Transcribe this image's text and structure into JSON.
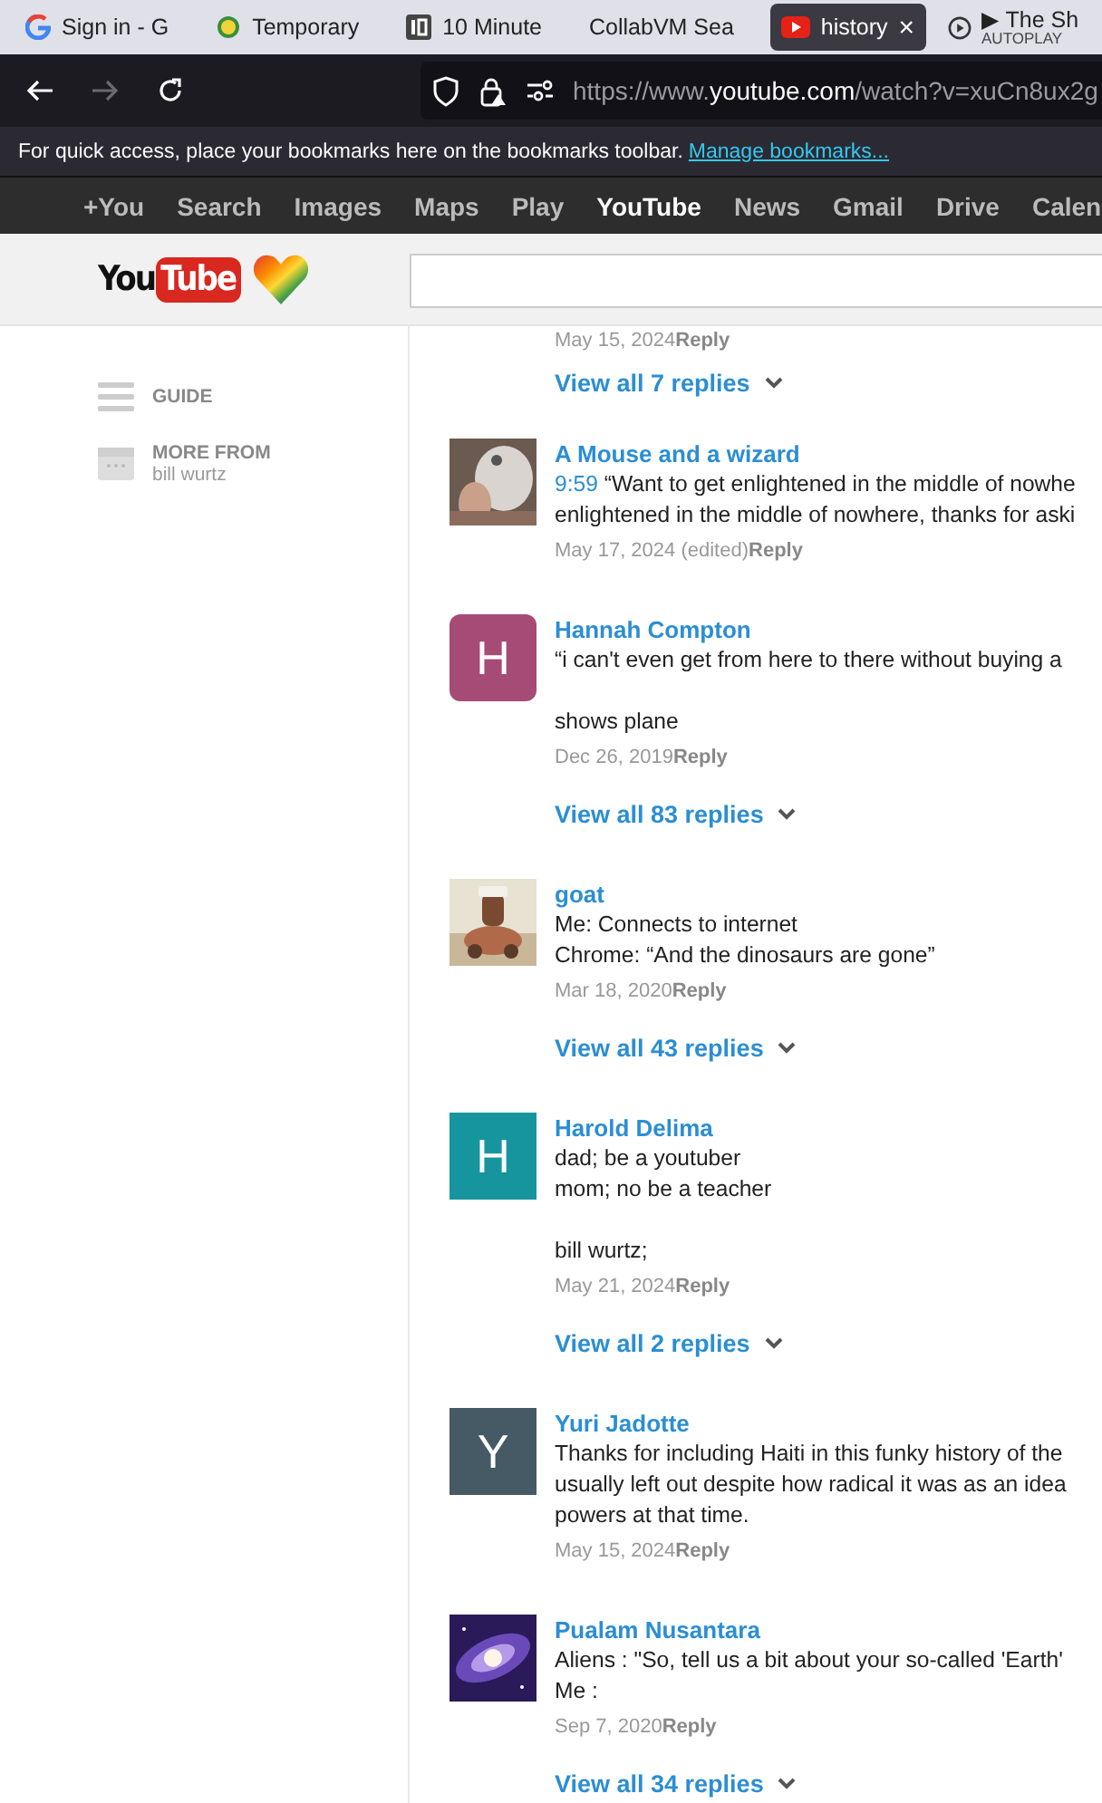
{
  "tabs": [
    {
      "label": "Sign in - G",
      "selected": false
    },
    {
      "label": "Temporary",
      "selected": false
    },
    {
      "label": "10 Minute",
      "selected": false
    },
    {
      "label": "CollabVM Sea",
      "selected": false
    },
    {
      "label": "history",
      "selected": true,
      "close": "×"
    },
    {
      "label": "▶ The Sh",
      "sublabel": "AUTOPLAY",
      "selected": false
    }
  ],
  "address_bar": {
    "url_prefix": "https://www.",
    "url_host": "youtube.com",
    "url_rest": "/watch?v=xuCn8ux2g"
  },
  "bookmarks_hint": {
    "text": "For quick access, place your bookmarks here on the bookmarks toolbar.",
    "link": "Manage bookmarks..."
  },
  "google_bar": [
    {
      "label": "+You",
      "selected": false
    },
    {
      "label": "Search",
      "selected": false
    },
    {
      "label": "Images",
      "selected": false
    },
    {
      "label": "Maps",
      "selected": false
    },
    {
      "label": "Play",
      "selected": false
    },
    {
      "label": "YouTube",
      "selected": true
    },
    {
      "label": "News",
      "selected": false
    },
    {
      "label": "Gmail",
      "selected": false
    },
    {
      "label": "Drive",
      "selected": false
    },
    {
      "label": "Calen",
      "selected": false
    }
  ],
  "logo": {
    "left": "You",
    "right": "Tube"
  },
  "sidebar": {
    "items": [
      {
        "kind": "guide",
        "label": "GUIDE"
      },
      {
        "kind": "channel",
        "label": "MORE FROM",
        "sublabel": "bill wurtz"
      }
    ]
  },
  "top_fragment": {
    "date": "May 15, 2024",
    "reply": "Reply",
    "replies": "View all 7 replies"
  },
  "comments": [
    {
      "author": "A Mouse and a wizard",
      "avatar": {
        "kind": "picture"
      },
      "timestamp": "9:59",
      "paragraphs": [
        [
          "“Want to get enlightened in the middle of nowhe",
          "enlightened in the middle of nowhere, thanks for aski"
        ]
      ],
      "date": "May 17, 2024 (edited)",
      "reply": "Reply"
    },
    {
      "author": "Hannah Compton",
      "avatar": {
        "kind": "letter",
        "initial": "H",
        "color": "#a64b76"
      },
      "paragraphs": [
        [
          "“i can't even get from here to there without buying a"
        ],
        [
          "shows plane"
        ]
      ],
      "date": "Dec 26, 2019",
      "reply": "Reply",
      "replies": "View all 83 replies"
    },
    {
      "author": "goat",
      "avatar": {
        "kind": "picture"
      },
      "paragraphs": [
        [
          "Me: Connects to internet",
          "Chrome: “And the dinosaurs are gone”"
        ]
      ],
      "date": "Mar 18, 2020",
      "reply": "Reply",
      "replies": "View all 43 replies"
    },
    {
      "author": "Harold Delima",
      "avatar": {
        "kind": "letter",
        "initial": "H",
        "color": "#17959f"
      },
      "paragraphs": [
        [
          "dad; be a youtuber",
          "mom; no be a teacher"
        ],
        [
          "bill wurtz;"
        ]
      ],
      "date": "May 21, 2024",
      "reply": "Reply",
      "replies": "View all 2 replies"
    },
    {
      "author": "Yuri Jadotte",
      "avatar": {
        "kind": "letter",
        "initial": "Y",
        "color": "#455a64"
      },
      "paragraphs": [
        [
          "Thanks for including Haiti in this funky history of the",
          "usually left out despite how radical it was as an idea",
          "powers at that time."
        ]
      ],
      "date": "May 15, 2024",
      "reply": "Reply"
    },
    {
      "author": "Pualam Nusantara",
      "avatar": {
        "kind": "picture"
      },
      "paragraphs": [
        [
          "Aliens : \"So, tell us a bit about your so-called 'Earth'",
          "Me :"
        ]
      ],
      "date": "Sep 7, 2020",
      "reply": "Reply",
      "replies": "View all 34 replies"
    }
  ]
}
